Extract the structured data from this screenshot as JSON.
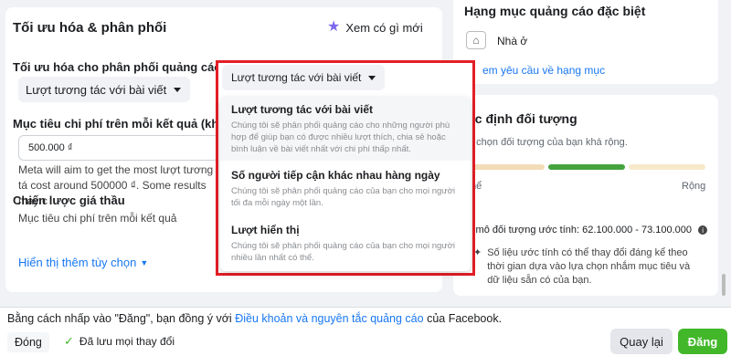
{
  "left_panel": {
    "title": "Tối ưu hóa & phân phối",
    "whats_new": "Xem có gì mới",
    "optimization_label": "Tối ưu hóa cho phân phối quảng cáo",
    "optimization_value": "Lượt tương tác với bài viết",
    "cost_label": "Mục tiêu chi phí trên mỗi kết quả (không b",
    "cost_value": "500.000 ₫",
    "meta_text": "Meta will aim to get the most lượt tương tá cost around 500000 ₫. Some results may c",
    "strategy_label": "Chiến lược giá thầu",
    "strategy_value": "Mục tiêu chi phí trên mỗi kết quả",
    "more_options": "Hiển thị thêm tùy chọn"
  },
  "right_panel": {
    "title": "Hạng mục quảng cáo đặc biệt",
    "category": "Nhà ở",
    "request_link": "em yêu cầu về hạng mục",
    "audience_title": "ác định đối tượng",
    "audience_sub": "a chọn đối tượng của bạn khá rộng.",
    "gauge_left": "thể",
    "gauge_right": "Rộng",
    "estimate": "y mô đối tượng ước tính: 62.100.000 - 73.100.000",
    "note": "Số liệu ước tính có thể thay đổi đáng kể theo thời gian dựa vào lựa chọn nhắm mục tiêu và dữ liệu sẵn có của bạn."
  },
  "dropdown": {
    "button_label": "Lượt tương tác với bài viết",
    "options": [
      {
        "title": "Lượt tương tác với bài viết",
        "desc": "Chúng tôi sẽ phân phối quảng cáo cho những người phù hợp để giúp bạn có được nhiều lượt thích, chia sẻ hoặc bình luận về bài viết nhất với chi phí thấp nhất."
      },
      {
        "title": "Số người tiếp cận khác nhau hàng ngày",
        "desc": "Chúng tôi sẽ phân phối quảng cáo của bạn cho mọi người tối đa mỗi ngày một lần."
      },
      {
        "title": "Lượt hiển thị",
        "desc": "Chúng tôi sẽ phân phối quảng cáo của bạn cho mọi người nhiều lần nhất có thể."
      }
    ]
  },
  "footer": {
    "terms_prefix": "Bằng cách nhấp vào \"Đăng\", bạn đồng ý với ",
    "terms_link": "Điều khoản và nguyên tắc quảng cáo",
    "terms_suffix": " của Facebook.",
    "close": "Đóng",
    "saved": "Đã lưu mọi thay đổi",
    "back": "Quay lại",
    "publish": "Đăng"
  },
  "icons": {
    "whats_new": "star-icon",
    "home": "home-icon",
    "info": "info-icon",
    "check": "check-icon"
  },
  "colors": {
    "accent": "#1877f2",
    "publish": "#42b72a",
    "highlight_border": "#e41e26",
    "gauge_good": "#44a33d"
  }
}
